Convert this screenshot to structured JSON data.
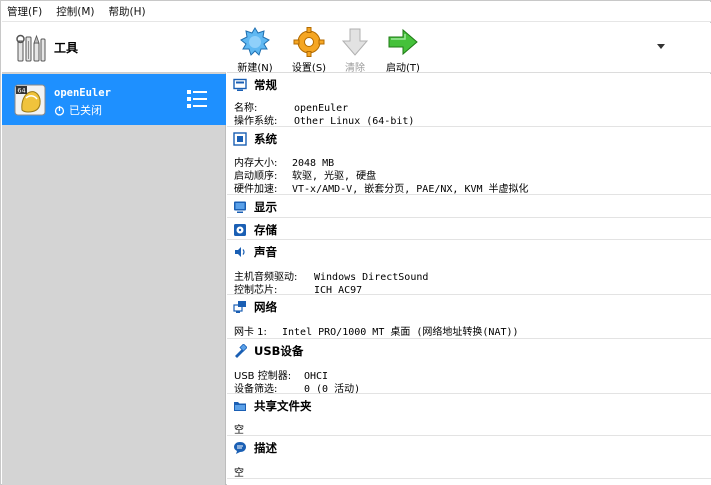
{
  "menubar": {
    "items": [
      "管理(F)",
      "控制(M)",
      "帮助(H)"
    ]
  },
  "left_pane": {
    "tools_label": "工具",
    "vm": {
      "os_badge": "64",
      "name": "openEuler",
      "state": "已关闭"
    }
  },
  "toolbar": {
    "new_label": "新建(N)",
    "settings_label": "设置(S)",
    "discard_label": "清除",
    "start_label": "启动(T)"
  },
  "details": {
    "general": {
      "title": "常规",
      "name_key": "名称:",
      "name_val": "openEuler",
      "os_key": "操作系统:",
      "os_val": "Other Linux (64-bit)"
    },
    "system": {
      "title": "系统",
      "mem_key": "内存大小:",
      "mem_val": "2048 MB",
      "boot_key": "启动顺序:",
      "boot_val": "软驱, 光驱, 硬盘",
      "accel_key": "硬件加速:",
      "accel_val": "VT-x/AMD-V, 嵌套分页, PAE/NX, KVM 半虚拟化"
    },
    "display": {
      "title": "显示"
    },
    "storage": {
      "title": "存储"
    },
    "audio": {
      "title": "声音",
      "driver_key": "主机音频驱动:",
      "driver_val": "Windows DirectSound",
      "chip_key": "控制芯片:",
      "chip_val": "ICH AC97"
    },
    "network": {
      "title": "网络",
      "nic_key": "网卡 1:",
      "nic_val": "Intel PRO/1000 MT 桌面 (网络地址转换(NAT))"
    },
    "usb": {
      "title": "USB设备",
      "ctrl_key": "USB 控制器:",
      "ctrl_val": "OHCI",
      "filter_key": "设备筛选:",
      "filter_val": "0 (0 活动)"
    },
    "shared": {
      "title": "共享文件夹",
      "value": "空"
    },
    "description": {
      "title": "描述",
      "value": "空"
    }
  },
  "colors": {
    "selection": "#1e90ff",
    "left_bg": "#d4d4d4",
    "section_icon": "#1a5fb4",
    "start_green": "#3cb52c",
    "settings_orange": "#f5a623",
    "new_blue": "#3fa9f5"
  }
}
